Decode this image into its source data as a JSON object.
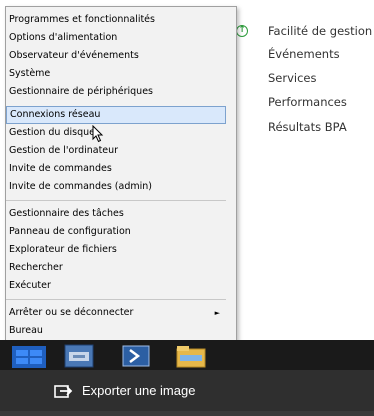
{
  "background_panel": {
    "items": [
      "Facilité de gestion",
      "Événements",
      "Services",
      "Performances",
      "Résultats BPA"
    ],
    "status_color": "#2d9c3c"
  },
  "menu": {
    "groups": [
      [
        "Programmes et fonctionnalités",
        "Options d'alimentation",
        "Observateur d'événements",
        "Système",
        "Gestionnaire de périphériques",
        "Connexions réseau",
        "Gestion du disque",
        "Gestion de l'ordinateur",
        "Invite de commandes",
        "Invite de commandes (admin)"
      ],
      [
        "Gestionnaire des tâches",
        "Panneau de configuration",
        "Explorateur de fichiers",
        "Rechercher",
        "Exécuter"
      ],
      [
        "Arrêter ou se déconnecter",
        "Bureau"
      ]
    ],
    "hovered_item": "Connexions réseau",
    "submenu_item": "Arrêter ou se déconnecter"
  },
  "taskbar": {
    "icons": [
      "windows-start-icon",
      "server-manager-icon",
      "powershell-icon",
      "file-explorer-icon"
    ]
  },
  "toolbar": {
    "export_label": "Exporter une image",
    "export_icon": "export-icon"
  }
}
